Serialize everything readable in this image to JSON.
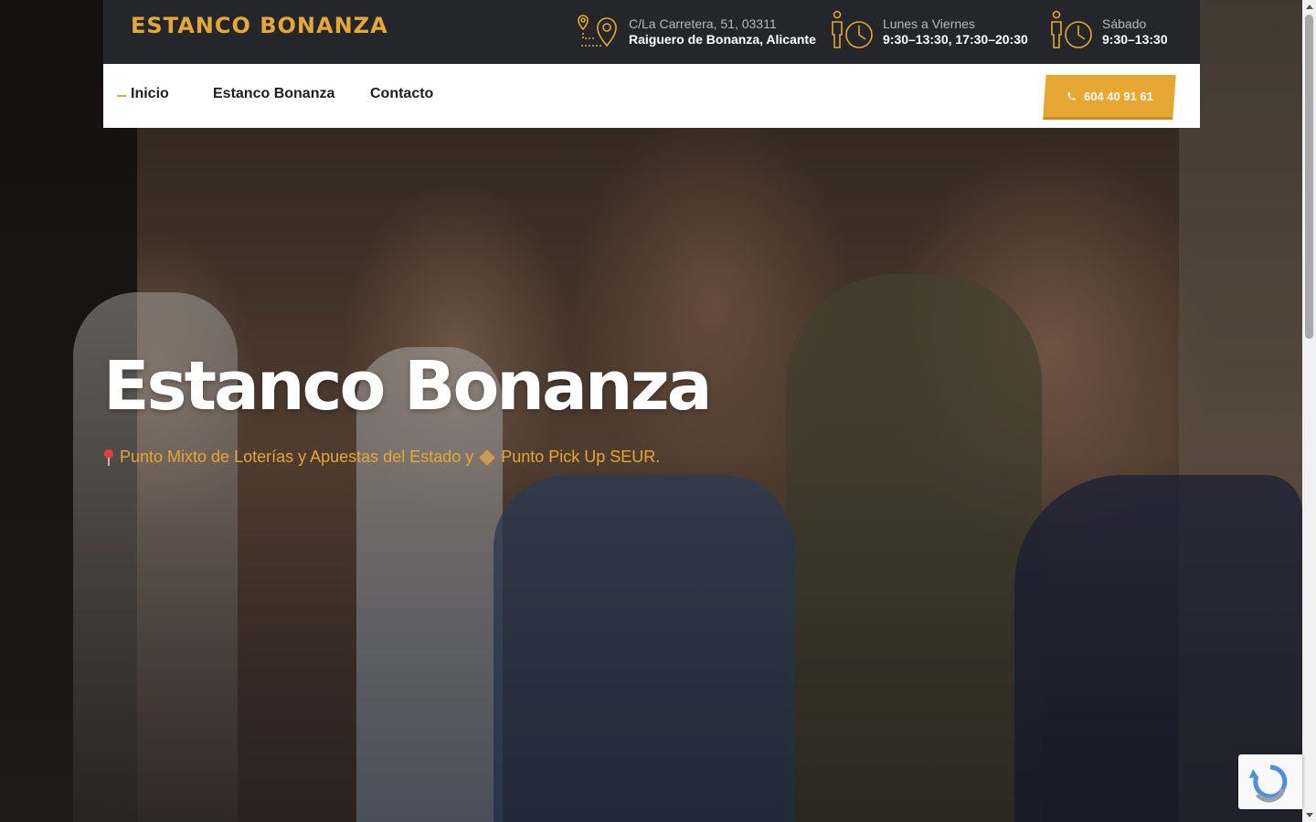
{
  "brand": {
    "logo_text": "ESTANCO BONANZA",
    "accent": "#e6a734",
    "dark": "#25262b"
  },
  "topbar": {
    "address": {
      "line1": "C/La Carretera, 51, 03311",
      "line2": "Raiguero de Bonanza, Alicante",
      "icon": "map-pin-icon"
    },
    "weekday_hours": {
      "line1": "Lunes a Viernes",
      "line2": "9:30–13:30, 17:30–20:30",
      "icon": "person-clock-icon"
    },
    "saturday_hours": {
      "line1": "Sábado",
      "line2": "9:30–13:30",
      "icon": "person-clock-icon"
    }
  },
  "nav": {
    "items": [
      {
        "label": "Inicio",
        "active": true
      },
      {
        "label": "Estanco Bonanza",
        "active": false
      },
      {
        "label": "Contacto",
        "active": false
      }
    ],
    "phone": {
      "label": "604 40 91 61",
      "icon": "phone-icon"
    }
  },
  "hero": {
    "title": "Estanco Bonanza",
    "subtitle_part1": "Punto Mixto de Loterías y Apuestas del Estado y",
    "subtitle_part2": "Punto Pick Up SEUR."
  }
}
